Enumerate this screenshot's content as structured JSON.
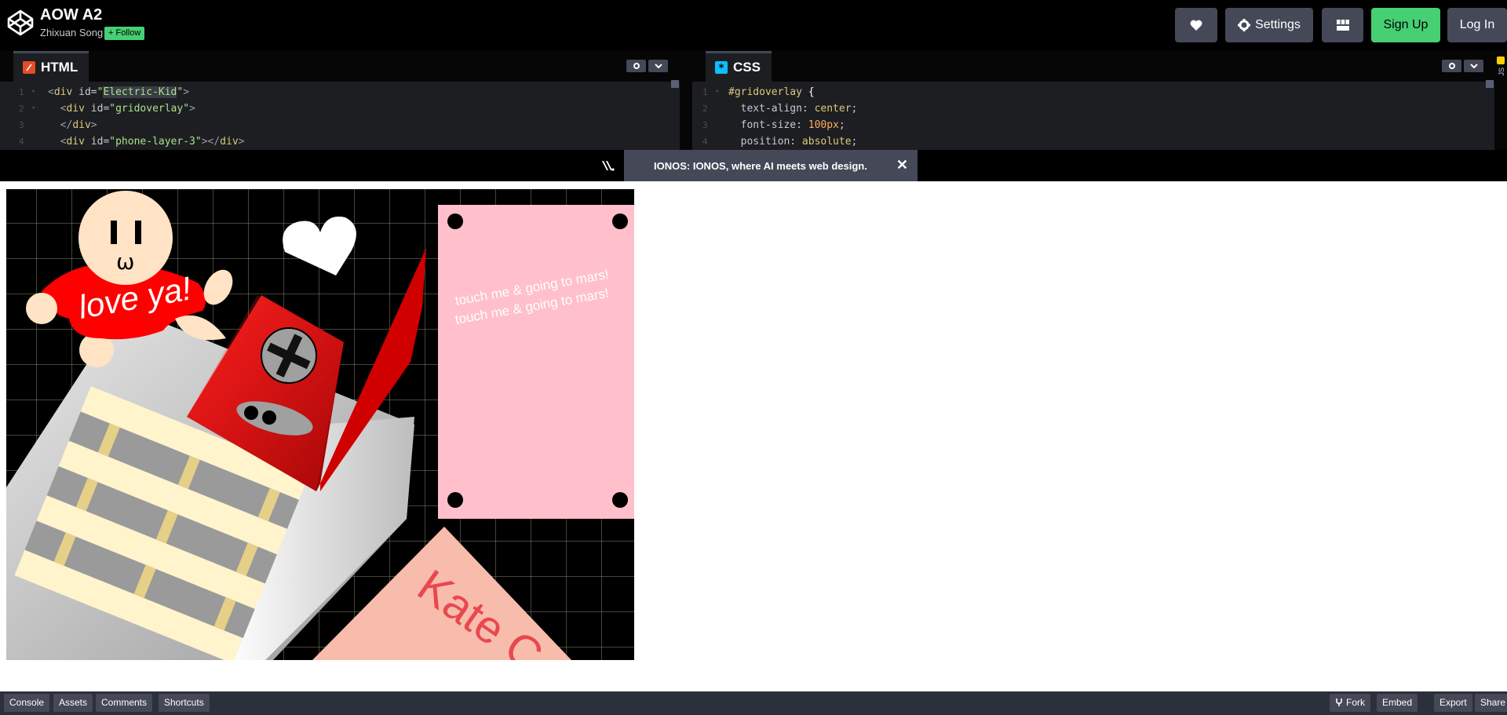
{
  "header": {
    "title": "AOW A2",
    "author": "Zhixuan Song",
    "follow_label": "+ Follow",
    "settings_label": "Settings",
    "signup_label": "Sign Up",
    "login_label": "Log In"
  },
  "editors": {
    "html": {
      "label": "HTML",
      "lines": [
        {
          "n": "1",
          "t": "<div id=\"Electric-Kid\">"
        },
        {
          "n": "2",
          "t": "  <div id=\"gridoverlay\">"
        },
        {
          "n": "3",
          "t": "  </div>"
        },
        {
          "n": "4",
          "t": "  <div id=\"phone-layer-3\"></div>"
        }
      ]
    },
    "css": {
      "label": "CSS",
      "lines": [
        {
          "n": "1",
          "t": "#gridoverlay {"
        },
        {
          "n": "2",
          "t": "  text-align: center;"
        },
        {
          "n": "3",
          "t": "  font-size: 100px;"
        },
        {
          "n": "4",
          "t": "  position: absolute;"
        }
      ]
    },
    "js_label": "JS"
  },
  "ad": {
    "text": "IONOS: IONOS, where AI meets web design."
  },
  "preview": {
    "shirt_text": "love ya!",
    "face_eyes": "I I",
    "face_mouth": "ω",
    "card_text_1": "touch me & going to mars!",
    "card_text_2": "touch me & going to mars!",
    "bottom_card_text": "Kate C"
  },
  "footer": {
    "console": "Console",
    "assets": "Assets",
    "comments": "Comments",
    "shortcuts": "Shortcuts",
    "fork": "Fork",
    "embed": "Embed",
    "export": "Export",
    "share": "Share"
  },
  "colors": {
    "accent_green": "#47cf73",
    "button_gray": "#444857",
    "editor_bg": "#1d1e22"
  }
}
